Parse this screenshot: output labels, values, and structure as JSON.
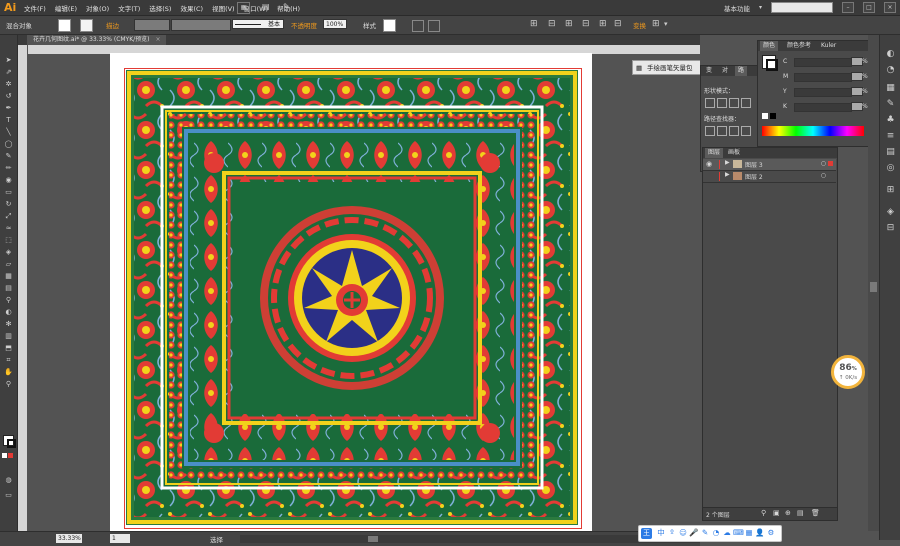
{
  "app": {
    "logo": "Ai",
    "workspace": "基本功能"
  },
  "menu": [
    "文件(F)",
    "编辑(E)",
    "对象(O)",
    "文字(T)",
    "选择(S)",
    "效果(C)",
    "视图(V)",
    "窗口(W)",
    "帮助(H)"
  ],
  "control_bar": {
    "blend_label": "混合对象",
    "stroke_label": "描边",
    "stroke_style": "基本",
    "opacity_label": "不透明度",
    "opacity_value": "100%",
    "style_label": "样式",
    "transform_label": "变换"
  },
  "document": {
    "tab_title": "花卉几何图纹.ai* @ 33.33% (CMYK/预览)"
  },
  "tooltip": {
    "text": "手绘画笔矢量包"
  },
  "panels": {
    "transform_tabs": [
      "变",
      "对",
      "路"
    ],
    "shape_mode_label": "形状模式：",
    "pathfinder_label": "路径查找器：",
    "color_tabs": [
      "颜色",
      "颜色参考",
      "Kuler"
    ],
    "cmyk_labels": [
      "C",
      "M",
      "Y",
      "K"
    ],
    "percent": "%"
  },
  "layers_panel": {
    "tabs": [
      "图层",
      "画板"
    ],
    "rows": [
      {
        "name": "图层 3"
      },
      {
        "name": "图层 2"
      }
    ],
    "footer": "2 个图层"
  },
  "status_bar": {
    "zoom": "33.33%",
    "page": "1",
    "tool": "选择"
  },
  "speed_badge": {
    "percent": "86",
    "unit": "%",
    "rate": "↑ 0K/s"
  },
  "ime_bar": {
    "lang": "中"
  },
  "colors": {
    "pattern_green": "#1a6b3a",
    "pattern_red": "#e23b35",
    "pattern_yellow": "#f2d21b",
    "pattern_blue": "#4a8fc7",
    "pattern_navy": "#2b2f86",
    "accent_orange": "#f29b1d"
  }
}
